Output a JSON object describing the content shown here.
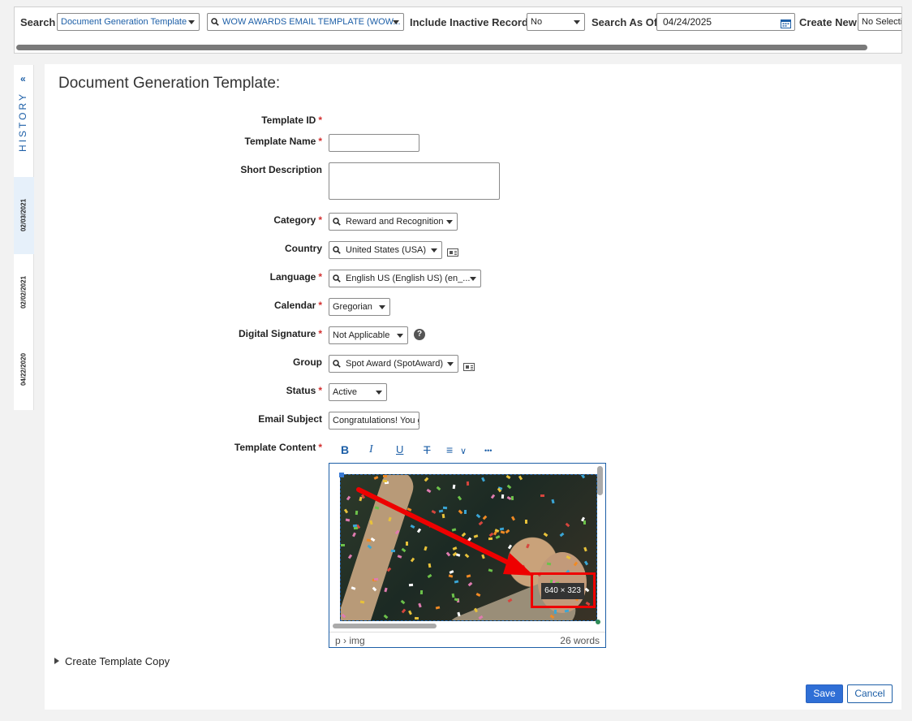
{
  "topbar": {
    "search_label": "Search",
    "search_type_value": "Document Generation Template",
    "search_record_value": "WOW AWARDS EMAIL TEMPLATE (WOW...",
    "inactive_label": "Include Inactive Records",
    "inactive_value": "No",
    "asof_label": "Search As Of:",
    "asof_value": "04/24/2025",
    "create_label": "Create New",
    "create_value": "No Selection"
  },
  "history": {
    "label": "HISTORY",
    "collapse_glyph": "«",
    "dates": [
      "02/03/2021",
      "02/02/2021",
      "04/22/2020"
    ]
  },
  "form": {
    "title": "Document Generation Template:",
    "template_id_label": "Template ID",
    "template_name_label": "Template Name",
    "template_name_value": "",
    "short_desc_label": "Short Description",
    "short_desc_value": "",
    "category_label": "Category",
    "category_value": "Reward and Recognition",
    "country_label": "Country",
    "country_value": "United States (USA)",
    "language_label": "Language",
    "language_value": "English US (English US) (en_...",
    "calendar_label": "Calendar",
    "calendar_value": "Gregorian",
    "digsig_label": "Digital Signature",
    "digsig_value": "Not Applicable",
    "help_glyph": "?",
    "group_label": "Group",
    "group_value": "Spot Award (SpotAward)",
    "status_label": "Status",
    "status_value": "Active",
    "email_subject_label": "Email Subject",
    "email_subject_value": "Congratulations! You go",
    "content_label": "Template Content",
    "required_mark": "*"
  },
  "toolbar": {
    "bold": "B",
    "italic": "I",
    "underline": "U",
    "strike": "T",
    "align": "≡",
    "align_caret": "∨",
    "more": "•••"
  },
  "editor": {
    "image_dimensions": "640 × 323",
    "path": "p › img",
    "word_count": "26 words"
  },
  "footer": {
    "copy_label": "Create Template Copy",
    "save_label": "Save",
    "cancel_label": "Cancel"
  },
  "colors": {
    "accent": "#1d5fa7",
    "required": "#d32f2f",
    "primary_button": "#2f6fd6",
    "annotation": "#e00000"
  }
}
